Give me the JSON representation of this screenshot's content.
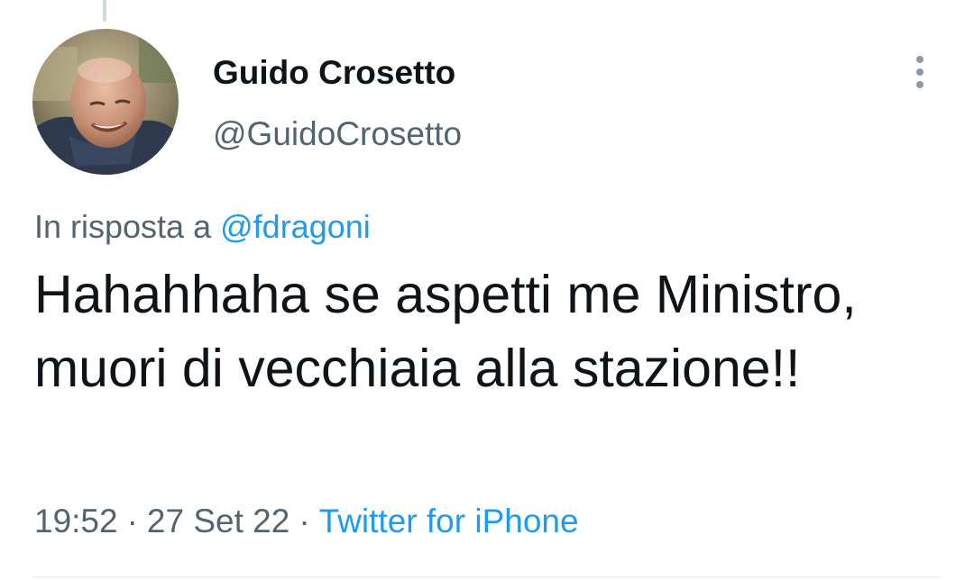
{
  "tweet": {
    "author": {
      "display_name": "Guido Crosetto",
      "handle": "@GuidoCrosetto",
      "avatar_icon": "profile-photo"
    },
    "more_icon": "vertical-ellipsis-icon",
    "reply_to": {
      "prefix": "In risposta a",
      "mention": "@fdragoni"
    },
    "text": "Hahahhaha se aspetti me Ministro, muori di vecchiaia alla stazione!!",
    "time": "19:52",
    "date": "27 Set 22",
    "separator": "·",
    "source": "Twitter for iPhone"
  },
  "colors": {
    "text_primary": "#0f1419",
    "text_secondary": "#536471",
    "accent": "#1d9bf0",
    "divider": "#eff3f4",
    "thread_line": "#cfd9de"
  }
}
